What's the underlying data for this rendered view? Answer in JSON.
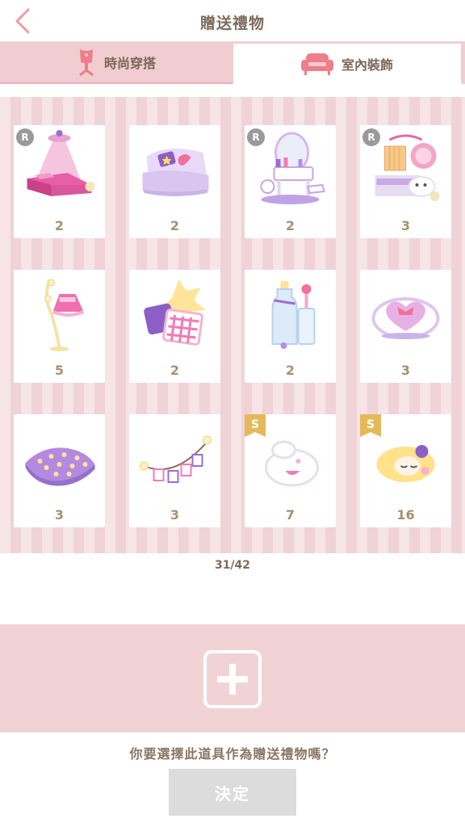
{
  "header": {
    "title": "贈送禮物",
    "back_icon": "chevron-left-icon"
  },
  "tabs": [
    {
      "label": "時尚穿搭",
      "icon": "mannequin-icon",
      "selected": false
    },
    {
      "label": "室內裝飾",
      "icon": "sofa-icon",
      "selected": true
    }
  ],
  "items": [
    {
      "name": "canopy-bed",
      "count": "2",
      "badge": "R"
    },
    {
      "name": "sofa",
      "count": "2",
      "badge": ""
    },
    {
      "name": "vanity-table",
      "count": "2",
      "badge": "R"
    },
    {
      "name": "wardrobe-set",
      "count": "3",
      "badge": "R"
    },
    {
      "name": "floor-lamp",
      "count": "5",
      "badge": ""
    },
    {
      "name": "cushion-pile",
      "count": "2",
      "badge": ""
    },
    {
      "name": "bottle-decor",
      "count": "2",
      "badge": ""
    },
    {
      "name": "heart-cushion",
      "count": "3",
      "badge": ""
    },
    {
      "name": "dotted-cushion",
      "count": "3",
      "badge": ""
    },
    {
      "name": "photo-garland",
      "count": "3",
      "badge": ""
    },
    {
      "name": "plush-bunny",
      "count": "7",
      "badge": "S"
    },
    {
      "name": "sleeping-doll",
      "count": "16",
      "badge": "S"
    }
  ],
  "pager": {
    "text": "31/42"
  },
  "add_slot": {
    "icon": "plus-icon"
  },
  "prompt": {
    "question": "你要選擇此道具作為贈送禮物嗎？"
  },
  "confirm": {
    "label": "決定"
  },
  "colors": {
    "accent": "#f1ccd0",
    "text": "#7d6b5c",
    "count": "#a8906f"
  }
}
